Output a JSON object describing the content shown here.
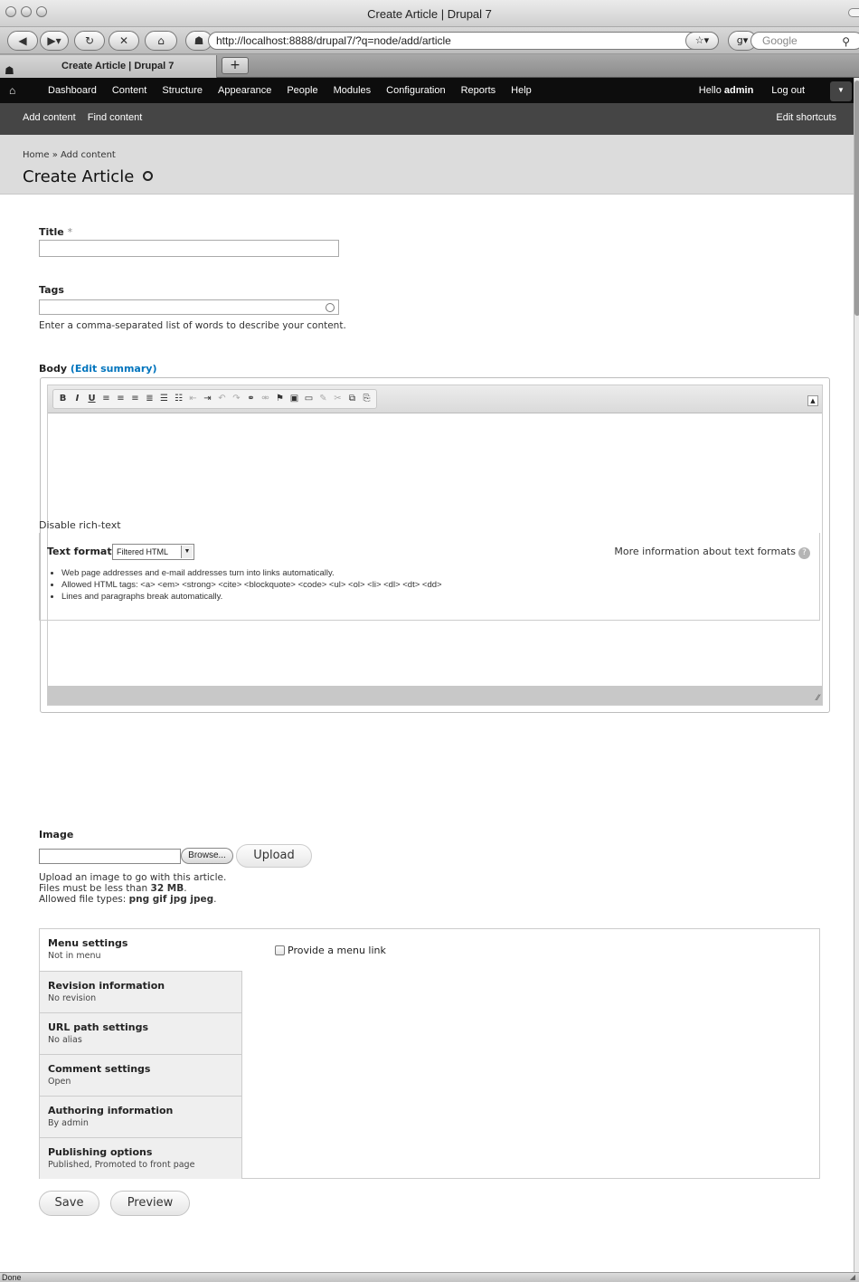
{
  "browser": {
    "window_title": "Create Article | Drupal 7",
    "url": "http://localhost:8888/drupal7/?q=node/add/article",
    "search_placeholder": "Google",
    "tab_title": "Create Article | Drupal 7",
    "new_tab_label": "+",
    "status_text": "Done"
  },
  "toolbar": {
    "menu": [
      "Dashboard",
      "Content",
      "Structure",
      "Appearance",
      "People",
      "Modules",
      "Configuration",
      "Reports",
      "Help"
    ],
    "greeting_prefix": "Hello ",
    "username": "admin",
    "logout": "Log out"
  },
  "shortcuts": {
    "items": [
      "Add content",
      "Find content"
    ],
    "edit": "Edit shortcuts"
  },
  "page": {
    "breadcrumb": "Home » Add content",
    "title": "Create Article"
  },
  "form": {
    "title_label": "Title",
    "required_mark": "*",
    "tags_label": "Tags",
    "tags_description": "Enter a comma-separated list of words to describe your content.",
    "body_label": "Body",
    "edit_summary": "(Edit summary)",
    "disable_rich_text": "Disable rich-text",
    "text_format_label": "Text format",
    "text_format_value": "Filtered HTML",
    "more_info": "More information about text formats",
    "format_tips": [
      "Web page addresses and e-mail addresses turn into links automatically.",
      "Allowed HTML tags: <a> <em> <strong> <cite> <blockquote> <code> <ul> <ol> <li> <dl> <dt> <dd>",
      "Lines and paragraphs break automatically."
    ],
    "image_label": "Image",
    "browse_button": "Browse...",
    "upload_button": "Upload",
    "image_help_1": "Upload an image to go with this article.",
    "image_help_2_prefix": "Files must be less than ",
    "image_help_2_size": "32 MB",
    "image_help_3_prefix": "Allowed file types: ",
    "image_help_3_types": "png gif jpg jpeg",
    "save_button": "Save",
    "preview_button": "Preview"
  },
  "vertical_tabs": [
    {
      "title": "Menu settings",
      "summary": "Not in menu"
    },
    {
      "title": "Revision information",
      "summary": "No revision"
    },
    {
      "title": "URL path settings",
      "summary": "No alias"
    },
    {
      "title": "Comment settings",
      "summary": "Open"
    },
    {
      "title": "Authoring information",
      "summary": "By admin"
    },
    {
      "title": "Publishing options",
      "summary": "Published, Promoted to front page"
    }
  ],
  "menu_pane": {
    "checkbox_label": "Provide a menu link"
  },
  "editor_buttons": [
    "bold-icon",
    "italic-icon",
    "underline-icon",
    "align-left-icon",
    "align-center-icon",
    "align-right-icon",
    "justify-icon",
    "bullet-list-icon",
    "numbered-list-icon",
    "outdent-icon",
    "indent-icon",
    "undo-icon",
    "redo-icon",
    "link-icon",
    "unlink-icon",
    "anchor-icon",
    "image-icon",
    "horizontal-rule-icon",
    "cleanup-icon",
    "cut-icon",
    "copy-icon",
    "paste-icon"
  ]
}
